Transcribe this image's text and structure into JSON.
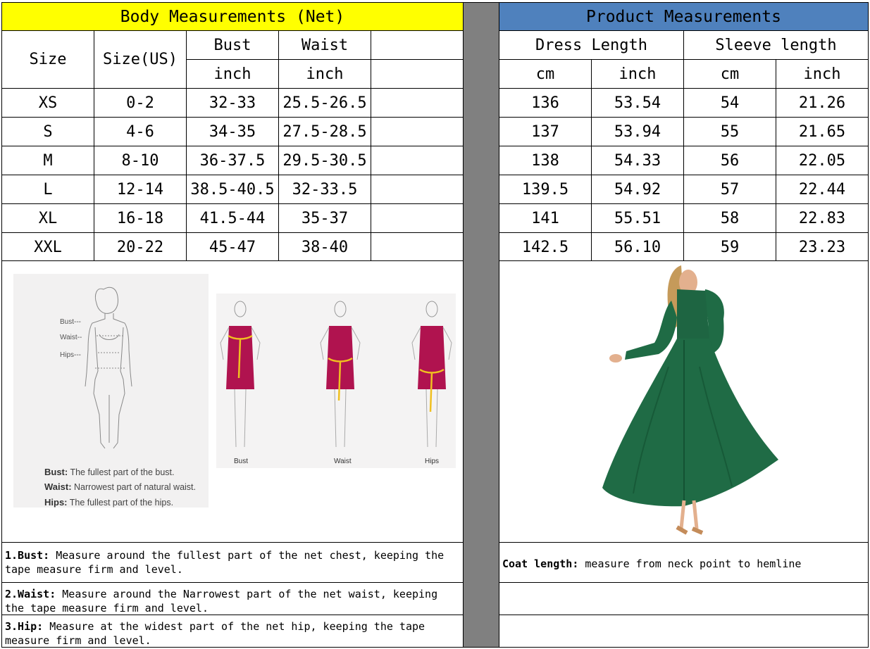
{
  "left_header": "Body Measurements (Net)",
  "right_header": "Product Measurements",
  "columns": {
    "size": "Size",
    "size_us": "Size(US)",
    "bust": "Bust",
    "waist": "Waist",
    "bust_unit": "inch",
    "waist_unit": "inch",
    "dress_length": "Dress Length",
    "sleeve_length": "Sleeve length",
    "dress_cm": "cm",
    "dress_inch": "inch",
    "sleeve_cm": "cm",
    "sleeve_inch": "inch"
  },
  "rows": [
    {
      "size": "XS",
      "us": "0-2",
      "bust": "32-33",
      "waist": "25.5-26.5",
      "dress_cm": "136",
      "dress_in": "53.54",
      "sleeve_cm": "54",
      "sleeve_in": "21.26"
    },
    {
      "size": "S",
      "us": "4-6",
      "bust": "34-35",
      "waist": "27.5-28.5",
      "dress_cm": "137",
      "dress_in": "53.94",
      "sleeve_cm": "55",
      "sleeve_in": "21.65"
    },
    {
      "size": "M",
      "us": "8-10",
      "bust": "36-37.5",
      "waist": "29.5-30.5",
      "dress_cm": "138",
      "dress_in": "54.33",
      "sleeve_cm": "56",
      "sleeve_in": "22.05"
    },
    {
      "size": "L",
      "us": "12-14",
      "bust": "38.5-40.5",
      "waist": "32-33.5",
      "dress_cm": "139.5",
      "dress_in": "54.92",
      "sleeve_cm": "57",
      "sleeve_in": "22.44"
    },
    {
      "size": "XL",
      "us": "16-18",
      "bust": "41.5-44",
      "waist": "35-37",
      "dress_cm": "141",
      "dress_in": "55.51",
      "sleeve_cm": "58",
      "sleeve_in": "22.83"
    },
    {
      "size": "XXL",
      "us": "20-22",
      "bust": "45-47",
      "waist": "38-40",
      "dress_cm": "142.5",
      "dress_in": "56.10",
      "sleeve_cm": "59",
      "sleeve_in": "23.23"
    }
  ],
  "figure": {
    "marker_bust": "Bust---",
    "marker_waist": "Waist--",
    "marker_hips": "Hips---",
    "legend": [
      {
        "term": "Bust:",
        "text": "The fullest part of the bust."
      },
      {
        "term": "Waist:",
        "text": "Narrowest part of natural waist."
      },
      {
        "term": "Hips:",
        "text": "The fullest part of the hips."
      }
    ],
    "captions": [
      "Bust",
      "Waist",
      "Hips"
    ]
  },
  "notes": [
    {
      "term": "1.Bust:",
      "text": "  Measure around the fullest part of the net chest, keeping the tape  measure firm and level."
    },
    {
      "term": "2.Waist:",
      "text": " Measure around the Narrowest part of the net waist, keeping the tape  measure firm and level."
    },
    {
      "term": "3.Hip:",
      "text": " Measure at the widest part of the net hip, keeping the tape measure firm and level."
    }
  ],
  "coat_note": {
    "term": "Coat length:",
    "text": " measure from neck point to hemline"
  },
  "colors": {
    "left_header_bg": "#ffff00",
    "right_header_bg": "#4f81bd",
    "divider_gray": "#808080",
    "dress_green": "#1f6b45",
    "tape_yellow": "#f0c020",
    "demo_dress": "#b0134f"
  }
}
